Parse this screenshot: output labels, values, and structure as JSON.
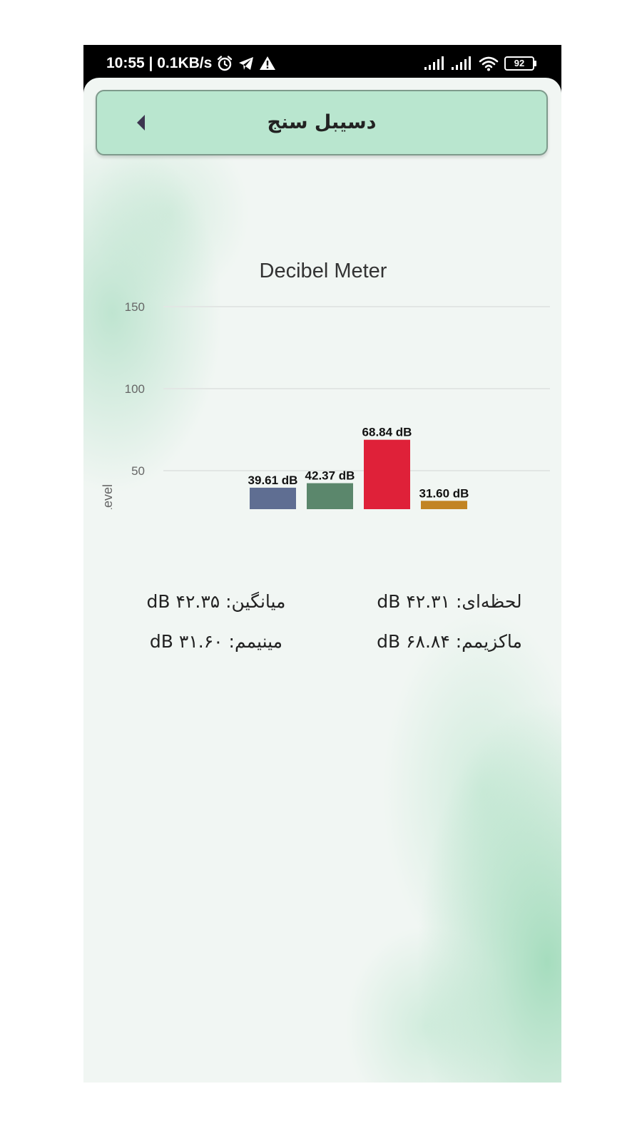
{
  "status_bar": {
    "time_speed": "10:55 | 0.1KB/s",
    "battery": "92",
    "icons": [
      "alarm-icon",
      "telegram-icon",
      "warning-icon",
      "signal-icon",
      "signal-icon",
      "wifi-icon",
      "battery-icon"
    ]
  },
  "header": {
    "title": "دسیبل سنج",
    "back_icon": "caret-left-icon"
  },
  "chart_data": {
    "type": "bar",
    "title": "Decibel Meter",
    "ylabel": "dB Level",
    "ylim": [
      0,
      150
    ],
    "yticks": [
      0,
      50,
      100,
      150
    ],
    "grid": true,
    "legend_placement": "bottom",
    "series": [
      {
        "name": "لحظه‌ای",
        "value": 39.61,
        "label": "39.61 dB",
        "color": "#5f6e92"
      },
      {
        "name": "میانگین",
        "value": 42.37,
        "label": "42.37 dB",
        "color": "#5b876c"
      },
      {
        "name": "ماکزیمم",
        "value": 68.84,
        "label": "68.84 dB",
        "color": "#df2139"
      },
      {
        "name": "مینیمم",
        "value": 31.6,
        "label": "31.60 dB",
        "color": "#c28423"
      }
    ]
  },
  "stats": {
    "instant": "لحظه‌ای: ۴۲.۳۱ dB",
    "average": "میانگین: ۴۲.۳۵ dB",
    "maximum": "ماکزیمم: ۶۸.۸۴ dB",
    "minimum": "مینیمم: ۳۱.۶۰ dB"
  }
}
